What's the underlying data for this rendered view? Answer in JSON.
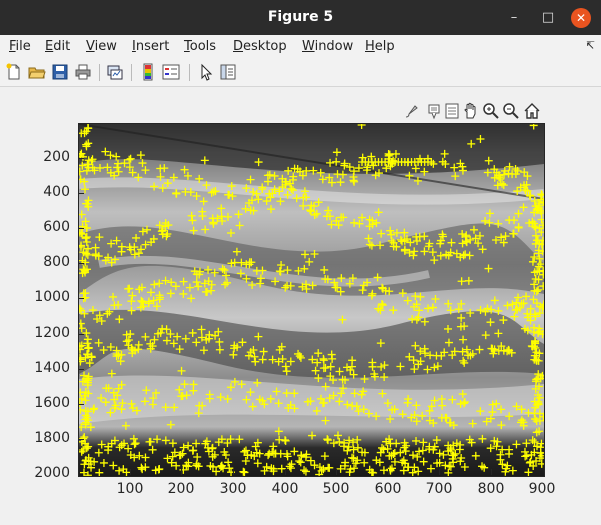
{
  "window": {
    "title": "Figure 5"
  },
  "menu": [
    "File",
    "Edit",
    "View",
    "Insert",
    "Tools",
    "Desktop",
    "Window",
    "Help"
  ],
  "menu_underline": [
    "F",
    "E",
    "V",
    "I",
    "T",
    "D",
    "W",
    "H"
  ],
  "toolbar_icons": [
    "new-figure-icon",
    "open-file-icon",
    "save-icon",
    "print-icon",
    "link-plot-icon",
    "insert-colorbar-icon",
    "insert-legend-icon",
    "edit-plot-icon",
    "property-inspector-icon"
  ],
  "axes_toolbar_icons": [
    "brush-icon",
    "data-tips-icon",
    "rotate-icon",
    "pan-icon",
    "zoom-in-icon",
    "zoom-out-icon",
    "home-icon"
  ],
  "axes": {
    "yticks": [
      "200",
      "400",
      "600",
      "800",
      "1000",
      "1200",
      "1400",
      "1600",
      "1800",
      "2000"
    ],
    "xticks": [
      "100",
      "200",
      "300",
      "400",
      "500",
      "600",
      "700",
      "800",
      "900"
    ],
    "xlim": [
      0,
      900
    ],
    "ylim": [
      0,
      2000
    ],
    "marker_color": "#ffff00",
    "marker_symbol": "+"
  }
}
